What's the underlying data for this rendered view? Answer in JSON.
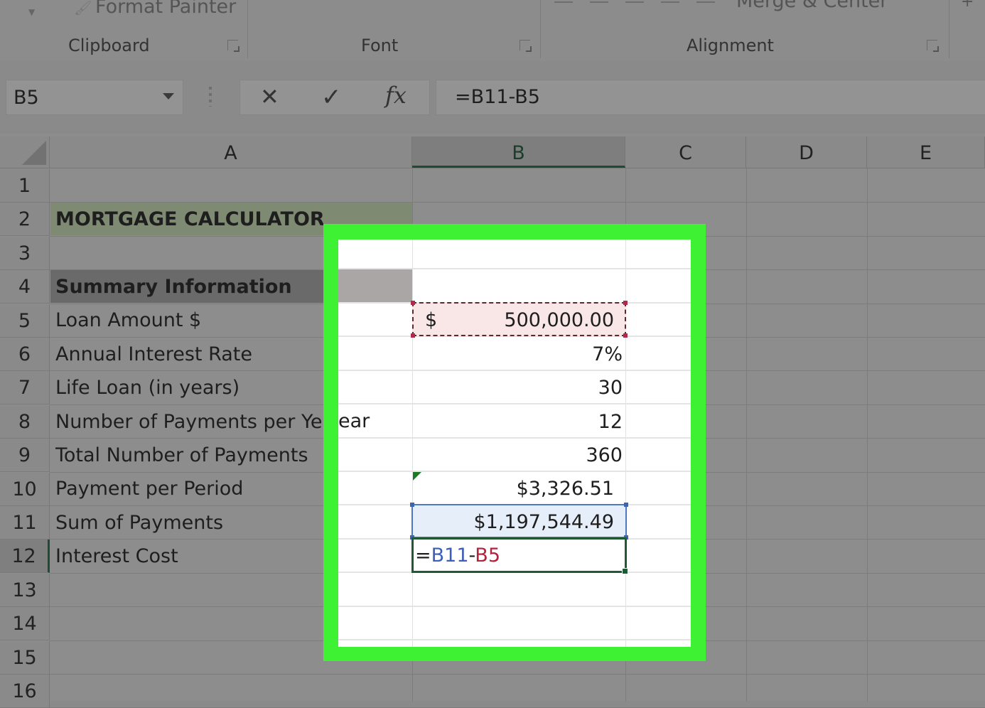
{
  "ribbon": {
    "format_painter_label": "Format Painter",
    "merge_center_label": "Merge & Center",
    "groups": [
      {
        "label": "Clipboard"
      },
      {
        "label": "Font"
      },
      {
        "label": "Alignment"
      }
    ]
  },
  "formula_bar": {
    "name_box": "B5",
    "cancel_icon": "✕",
    "enter_icon": "✓",
    "fx_label": "fx",
    "formula": "=B11-B5"
  },
  "columns": [
    "A",
    "B",
    "C",
    "D",
    "E"
  ],
  "selected_column": "B",
  "rows": [
    "1",
    "2",
    "3",
    "4",
    "5",
    "6",
    "7",
    "8",
    "9",
    "10",
    "11",
    "12",
    "13",
    "14",
    "15",
    "16"
  ],
  "selected_row": "12",
  "sheet": {
    "A2": "MORTGAGE CALCULATOR",
    "A4": "Summary Information",
    "A5": "Loan Amount $",
    "A6": "Annual Interest Rate",
    "A7": "Life Loan (in years)",
    "A8": "Number of Payments per Year",
    "A8_visible_tail": "ear",
    "A9": "Total Number of Payments",
    "A10": "Payment per Period",
    "A11": "Sum of Payments",
    "A12": "Interest Cost",
    "B5_currency": "$",
    "B5": "500,000.00",
    "B6": "7%",
    "B7": "30",
    "B8": "12",
    "B9": "360",
    "B10": "$3,326.51",
    "B11": "$1,197,544.49",
    "B12_editing": {
      "eq": "=",
      "ref1": "B11",
      "op": "-",
      "ref2": "B5"
    }
  },
  "colors": {
    "highlight_frame": "#3ef233",
    "ref_b11": "#3c5fb8",
    "ref_b5": "#b0243c",
    "active_cell_border": "#1f5a34"
  }
}
